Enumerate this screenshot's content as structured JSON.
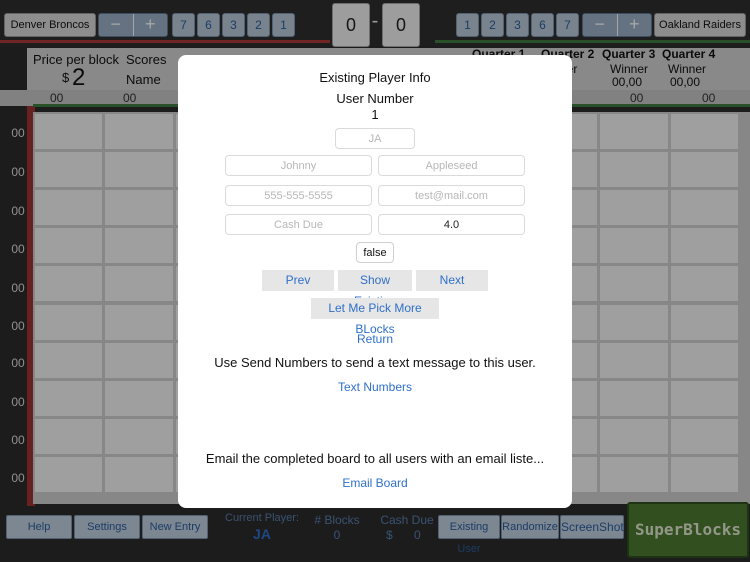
{
  "top": {
    "home_team": "Denver Broncos",
    "away_team": "Oakland Raiders",
    "home_score": "0",
    "away_score": "0",
    "score_separator": "-",
    "minus": "−",
    "plus": "+",
    "home_numbers": [
      "7",
      "6",
      "3",
      "2",
      "1"
    ],
    "away_numbers": [
      "1",
      "2",
      "3",
      "6",
      "7"
    ]
  },
  "info": {
    "price_label": "Price per block",
    "currency": "$",
    "price": "2",
    "scores_label": "Scores",
    "name_label": "Name",
    "quarters": [
      {
        "title": "Quarter 1",
        "winner": "",
        "score": ""
      },
      {
        "title": "Quarter 2",
        "winner": "ner",
        "score": ""
      },
      {
        "title": "Quarter 3",
        "winner": "Winner",
        "score": "00,00"
      },
      {
        "title": "Quarter 4",
        "winner": "Winner",
        "score": "00,00"
      }
    ]
  },
  "grid": {
    "col_headers": [
      "00",
      "00",
      "00",
      "00"
    ],
    "row_labels": [
      "00",
      "00",
      "00",
      "00",
      "00",
      "00",
      "00",
      "00",
      "00",
      "00"
    ]
  },
  "bottom": {
    "help": "Help",
    "settings": "Settings",
    "new_entry": "New Entry",
    "current_player_label": "Current Player:",
    "current_player": "JA",
    "blocks_label": "# Blocks",
    "blocks_value": "0",
    "cash_due_label": "Cash Due",
    "cash_currency": "$",
    "cash_due_value": "0",
    "existing_user": "Existing User",
    "randomize": "Randomize",
    "screenshot": "ScreenShot",
    "brand": "SuperBlocks"
  },
  "modal": {
    "title": "Existing Player Info",
    "user_number_label": "User Number",
    "user_number": "1",
    "initials_placeholder": "JA",
    "first_name_placeholder": "Johnny",
    "last_name_placeholder": "Appleseed",
    "phone_placeholder": "555-555-5555",
    "email_placeholder": "test@mail.com",
    "cash_due_placeholder": "Cash Due",
    "cash_due_value": "4.0",
    "paid_value": "false",
    "prev": "Prev",
    "show_existing": "Show Existing",
    "next": "Next",
    "pick_more": "Let Me Pick More BLocks",
    "return": "Return",
    "send_numbers_text": "Use Send Numbers to send a text message to this user.",
    "text_numbers": "Text Numbers",
    "email_text": "Email the completed board to all users with an email liste...",
    "email_board": "Email Board"
  },
  "colors": {
    "link_blue": "#2f6fc9",
    "home_line": "#b03a3a",
    "away_line": "#3f7d3f",
    "brand_green": "#4d7a32"
  }
}
